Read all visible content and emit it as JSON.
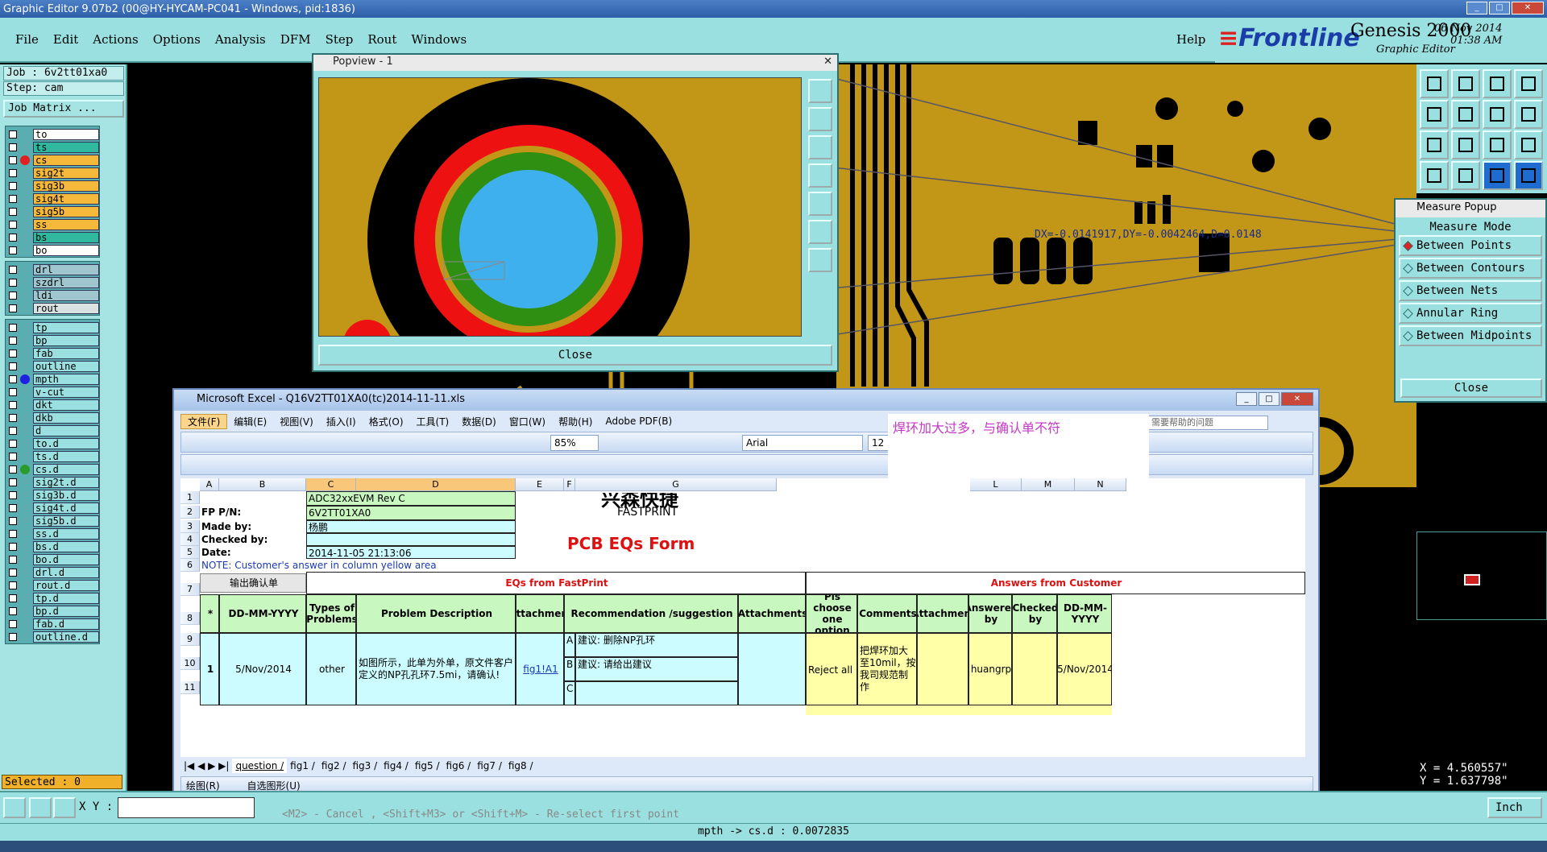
{
  "titlebar": {
    "title": "Graphic Editor 9.07b2 (00@HY-HYCAM-PC041 - Windows, pid:1836)"
  },
  "menu": {
    "items": [
      "File",
      "Edit",
      "Actions",
      "Options",
      "Analysis",
      "DFM",
      "Step",
      "Rout",
      "Windows"
    ],
    "help": "Help"
  },
  "brand": {
    "logo": "Frontline",
    "product": "Genesis 2000",
    "sub": "Graphic Editor",
    "date": "06 Nov 2014",
    "time": "01:38 AM"
  },
  "job": {
    "job": "Job : 6v2tt01xa0",
    "step": "Step: cam",
    "matrix": "Job Matrix ..."
  },
  "layers_group1": [
    {
      "name": "to",
      "color": "#ffffff"
    },
    {
      "name": "ts",
      "color": "#2fb89e"
    },
    {
      "name": "cs",
      "color": "#f5b83a",
      "dot": "#e02020"
    },
    {
      "name": "sig2t",
      "color": "#f5b83a"
    },
    {
      "name": "sig3b",
      "color": "#f5b83a"
    },
    {
      "name": "sig4t",
      "color": "#f5b83a"
    },
    {
      "name": "sig5b",
      "color": "#f5b83a"
    },
    {
      "name": "ss",
      "color": "#f5b83a"
    },
    {
      "name": "bs",
      "color": "#2fb89e"
    },
    {
      "name": "bo",
      "color": "#ffffff"
    }
  ],
  "layers_group2": [
    {
      "name": "drl",
      "color": "#9fc5cf"
    },
    {
      "name": "szdrl",
      "color": "#9fc5cf"
    },
    {
      "name": "ldi",
      "color": "#9fc5cf"
    },
    {
      "name": "rout",
      "color": "#d9e1e1"
    }
  ],
  "layers_group3": [
    {
      "name": "tp",
      "color": "#9ae0e0"
    },
    {
      "name": "bp",
      "color": "#9ae0e0"
    },
    {
      "name": "fab",
      "color": "#9ae0e0"
    },
    {
      "name": "outline",
      "color": "#9ae0e0"
    },
    {
      "name": "mpth",
      "color": "#9ae0e0",
      "dot": "#2020e0"
    },
    {
      "name": "v-cut",
      "color": "#9ae0e0"
    },
    {
      "name": "dkt",
      "color": "#9ae0e0"
    },
    {
      "name": "dkb",
      "color": "#9ae0e0"
    },
    {
      "name": "d",
      "color": "#9ae0e0"
    },
    {
      "name": "to.d",
      "color": "#9ae0e0"
    },
    {
      "name": "ts.d",
      "color": "#9ae0e0"
    },
    {
      "name": "cs.d",
      "color": "#9ae0e0",
      "dot": "#2a9a2a"
    },
    {
      "name": "sig2t.d",
      "color": "#9ae0e0"
    },
    {
      "name": "sig3b.d",
      "color": "#9ae0e0"
    },
    {
      "name": "sig4t.d",
      "color": "#9ae0e0"
    },
    {
      "name": "sig5b.d",
      "color": "#9ae0e0"
    },
    {
      "name": "ss.d",
      "color": "#9ae0e0"
    },
    {
      "name": "bs.d",
      "color": "#9ae0e0"
    },
    {
      "name": "bo.d",
      "color": "#9ae0e0"
    },
    {
      "name": "drl.d",
      "color": "#9ae0e0"
    },
    {
      "name": "rout.d",
      "color": "#9ae0e0"
    },
    {
      "name": "tp.d",
      "color": "#9ae0e0"
    },
    {
      "name": "bp.d",
      "color": "#9ae0e0"
    },
    {
      "name": "fab.d",
      "color": "#9ae0e0"
    },
    {
      "name": "outline.d",
      "color": "#9ae0e0"
    }
  ],
  "selected": "Selected : 0",
  "popview": {
    "title": "Popview - 1",
    "close": "Close"
  },
  "measure": {
    "title": "Measure Popup",
    "header": "Measure Mode",
    "options": [
      "Between Points",
      "Between Contours",
      "Between Nets",
      "Annular Ring",
      "Between Midpoints"
    ],
    "selected_index": 0,
    "close": "Close",
    "readout": "DX=-0.0141917,DY=-0.0042464,D=0.0148"
  },
  "coords": {
    "x": "X = 4.560557\"",
    "y": "Y = 1.637798\""
  },
  "bottom": {
    "xy_label": "X Y :",
    "prompt": "<M2> - Cancel , <Shift+M3> or <Shift+M> - Re-select first point",
    "unit": "Inch"
  },
  "status": "mpth -> cs.d : 0.0072835",
  "excel": {
    "title": "Microsoft Excel - Q16V2TT01XA0(tc)2014-11-11.xls",
    "menus": [
      "文件(F)",
      "编辑(E)",
      "视图(V)",
      "插入(I)",
      "格式(O)",
      "工具(T)",
      "数据(D)",
      "窗口(W)",
      "帮助(H)",
      "Adobe PDF(B)"
    ],
    "zoom": "85%",
    "font": "Arial",
    "size": "12",
    "comment": "焊环加大过多，与确认单不符",
    "help_placeholder": "需要帮助的问题",
    "columns": [
      "A",
      "B",
      "C",
      "D",
      "E",
      "F",
      "G",
      "L",
      "M",
      "N"
    ],
    "rows": [
      "1",
      "2",
      "3",
      "4",
      "5",
      "6",
      "7",
      "8",
      "9",
      "10",
      "11"
    ],
    "info": {
      "c1": "ADC32xxEVM Rev C",
      "fp_label": "FP P/N:",
      "fp_value": "6V2TT01XA0",
      "made_label": "Made by:",
      "made_value": "杨鹏",
      "checked_label": "Checked by:",
      "checked_value": "",
      "date_label": "Date:",
      "date_value": "2014-11-05 21:13:06",
      "note": "NOTE: Customer's  answer in column yellow area"
    },
    "logo": {
      "cn": "兴森快捷",
      "en": "FASTPRINT",
      "form": "PCB EQs Form"
    },
    "output_btn": "输出确认单",
    "section_fp": "EQs from FastPrint",
    "section_cust": "Answers from Customer",
    "headers": [
      "*",
      "DD-MM-YYYY",
      "Types of Problems",
      "Problem Description",
      "Attachment",
      "Recommendation /suggestion",
      "Attachments",
      "Pls choose one option",
      "Comments",
      "Attachment",
      "Answered by",
      "Checked by",
      "DD-MM-YYYY"
    ],
    "row1": {
      "no": "1",
      "date": "5/Nov/2014",
      "type": "other",
      "desc": "如图所示，此单为外单，原文件客户定义的NP孔孔环7.5mi，请确认!",
      "attach": "fig1!A1",
      "optA": "A",
      "recA": "建议: 删除NP孔环",
      "optB": "B",
      "recB": "建议: 请给出建议",
      "optC": "C",
      "choice": "Reject all",
      "comment": "把焊环加大至10mil，按我司规范制作",
      "answered": "huangrp",
      "date2": "5/Nov/2014"
    },
    "tabs": [
      "question",
      "fig1",
      "fig2",
      "fig3",
      "fig4",
      "fig5",
      "fig6",
      "fig7",
      "fig8"
    ],
    "drawbar": {
      "draw": "绘图(R)",
      "autoshape": "自选图形(U)"
    }
  }
}
